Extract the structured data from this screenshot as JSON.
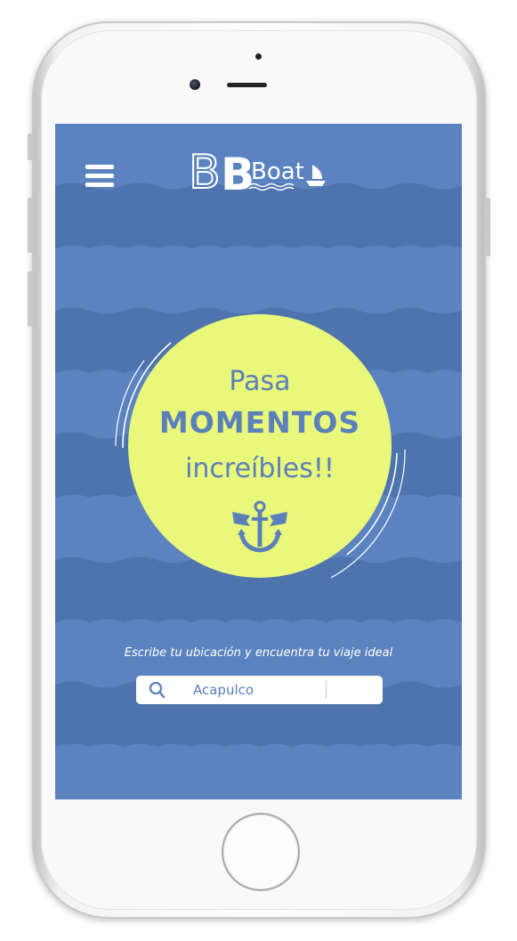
{
  "app": {
    "logo_text": "Boat",
    "logo_letter": "B"
  },
  "header": {
    "menu_icon": "hamburger-menu-icon"
  },
  "hero": {
    "line1": "Pasa",
    "line2": "MOMENTOS",
    "line3": "increíbles!!",
    "icon": "anchor-icon"
  },
  "search": {
    "tagline": "Escribe tu ubicación y encuentra tu viaje ideal",
    "value": "Acapulco",
    "icon": "search-icon"
  },
  "colors": {
    "background_blue": "#5b83bf",
    "wave_dark_blue": "#4e74ae",
    "hero_yellow": "#e9f77a",
    "text_blue": "#5a7fbb",
    "white": "#ffffff"
  },
  "device": {
    "home_button": "home-button",
    "camera": "front-camera",
    "speaker": "earpiece-speaker"
  }
}
